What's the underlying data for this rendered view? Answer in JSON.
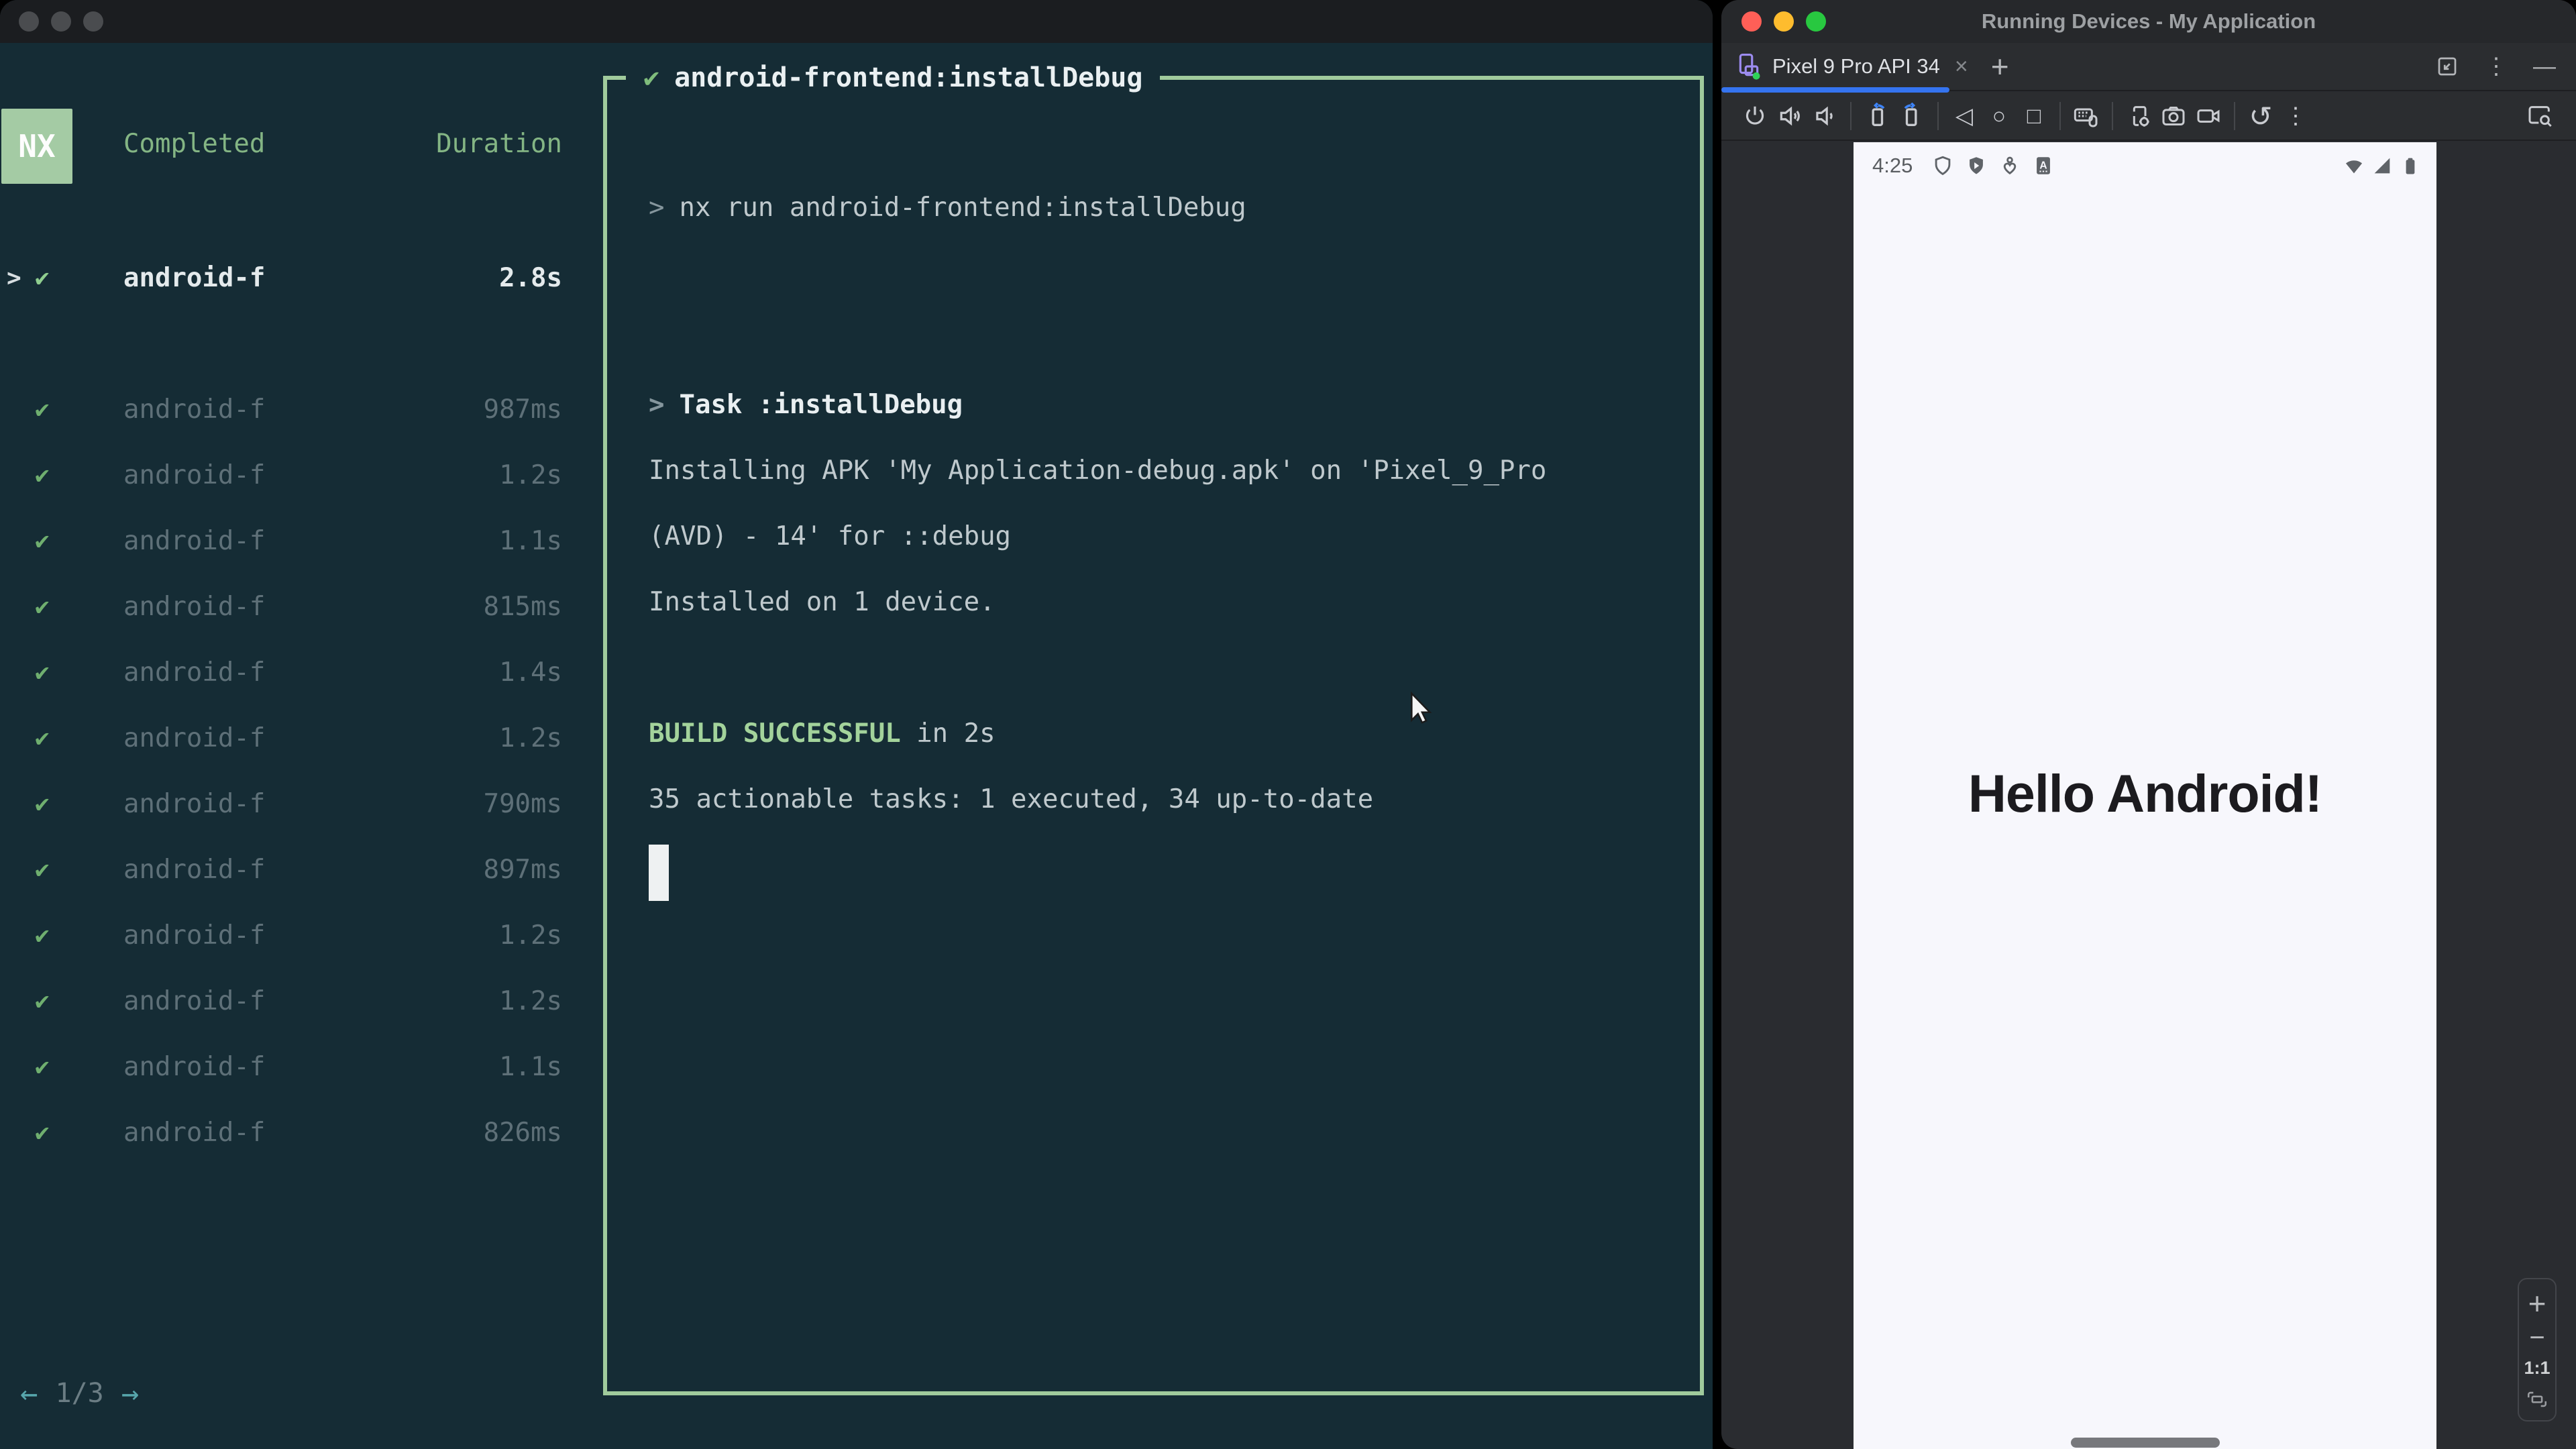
{
  "glyphs": {
    "check": "✔",
    "chevron": ">",
    "prompt": ">",
    "back": "◁",
    "home": "○",
    "overview": "□",
    "more_v": "⋮",
    "reboot": "↺",
    "minimize": "—",
    "close_tab": "×",
    "new_tab": "+",
    "zoom_in": "+",
    "zoom_out": "−",
    "arrow_left": "←",
    "arrow_right": "→"
  },
  "left_window": {
    "badge": "NX",
    "columns": {
      "completed": "Completed",
      "duration": "Duration"
    },
    "tasks": [
      {
        "name": "android-f",
        "duration": "2.8s",
        "active": true
      },
      {
        "name": "android-f",
        "duration": "987ms"
      },
      {
        "name": "android-f",
        "duration": "1.2s"
      },
      {
        "name": "android-f",
        "duration": "1.1s"
      },
      {
        "name": "android-f",
        "duration": "815ms"
      },
      {
        "name": "android-f",
        "duration": "1.4s"
      },
      {
        "name": "android-f",
        "duration": "1.2s"
      },
      {
        "name": "android-f",
        "duration": "790ms"
      },
      {
        "name": "android-f",
        "duration": "897ms"
      },
      {
        "name": "android-f",
        "duration": "1.2s"
      },
      {
        "name": "android-f",
        "duration": "1.2s"
      },
      {
        "name": "android-f",
        "duration": "1.1s"
      },
      {
        "name": "android-f",
        "duration": "826ms"
      }
    ],
    "pagination": {
      "page": "1/3"
    },
    "terminal": {
      "title": "android-frontend:installDebug",
      "command": "nx run android-frontend:installDebug",
      "task_heading": "Task :installDebug",
      "line_apk": "Installing APK 'My Application-debug.apk' on 'Pixel_9_Pro",
      "line_avd": "(AVD) - 14' for ::debug",
      "line_installed": "Installed on 1 device.",
      "build_status": "BUILD SUCCESSFUL",
      "build_suffix": "in 2s",
      "summary": "35 actionable tasks: 1 executed, 34 up-to-date"
    }
  },
  "right_window": {
    "title": "Running Devices - My Application",
    "tab_label": "Pixel 9 Pro API 34",
    "toolbar_icons": [
      "power",
      "volume-up",
      "volume-down",
      "rotate-left",
      "rotate-right",
      "back",
      "home",
      "overview",
      "hardware-input",
      "device-settings",
      "screenshot",
      "screen-record",
      "reboot",
      "more",
      "screen-search"
    ],
    "status_icons": [
      "shield-outline",
      "shield-play",
      "wellbeing",
      "auto-box",
      "wifi",
      "signal",
      "battery"
    ],
    "emulator": {
      "time": "4:25",
      "hello": "Hello Android!"
    },
    "zoom_panel": {
      "actual_size": "1:1"
    }
  },
  "colors": {
    "terminal_bg": "#152c35",
    "accent_green": "#a0cb9c",
    "badge_green": "#a4cba4",
    "check_green": "#79b979",
    "build_green": "#a3d39b",
    "tab_underline_blue": "#3574f0",
    "chrome_bg": "#2b2d30",
    "screen_bg": "#f7f7fc",
    "traffic_red": "#ff5f57",
    "traffic_yellow": "#febc2e",
    "traffic_green": "#28c840"
  }
}
